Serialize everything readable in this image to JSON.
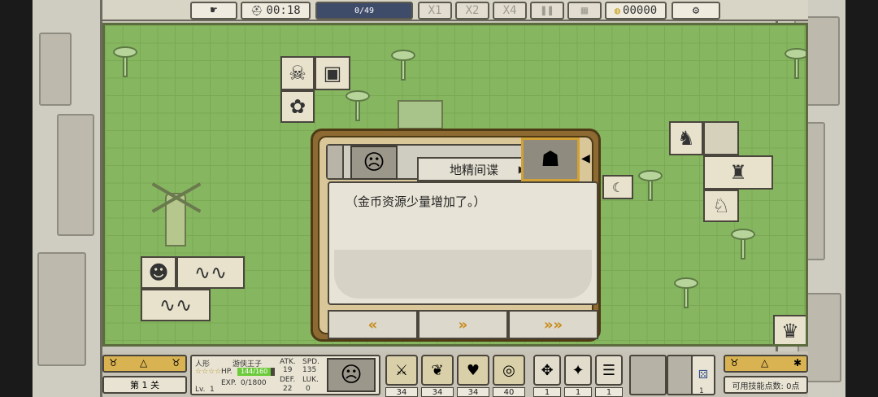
{
  "topbar": {
    "timer": "00:18",
    "progress_text": "0/49",
    "progress_fraction": 0.0,
    "speed_1x": "X1",
    "speed_2x": "X2",
    "speed_4x": "X4",
    "gold": "00000"
  },
  "dialog": {
    "speaker_name": "地精间谍",
    "message": "（金币资源少量增加了。）"
  },
  "hero": {
    "race": "人形",
    "name": "游侠王子",
    "hp_label": "HP.",
    "hp_value": "144/160",
    "hp_fraction": 0.9,
    "exp_label": "EXP.",
    "exp_value": "0/1800",
    "lv_label": "Lv.",
    "lv_value": "1",
    "atk_label": "ATK.",
    "atk_value": "19",
    "spd_label": "SPD.",
    "spd_value": "135",
    "def_label": "DEF.",
    "def_value": "22",
    "luk_label": "LUK.",
    "luk_value": "0"
  },
  "bottom": {
    "level_label": "第 1 关",
    "skill_points_label": "可用技能点数: 0点",
    "skills": [
      {
        "icon": "sword-icon",
        "value": "34"
      },
      {
        "icon": "wing-icon",
        "value": "34"
      },
      {
        "icon": "heart-icon",
        "value": "34"
      },
      {
        "icon": "shield-icon",
        "value": "40"
      }
    ],
    "items": [
      {
        "icon": "amulet-icon",
        "value": "1"
      },
      {
        "icon": "shuriken-icon",
        "value": "1"
      },
      {
        "icon": "scroll-icon",
        "value": "1"
      }
    ],
    "dice_value": "1"
  },
  "colors": {
    "board": "#86b760",
    "dialog_border": "#8c6a32",
    "accent_arrow": "#c88a18"
  }
}
